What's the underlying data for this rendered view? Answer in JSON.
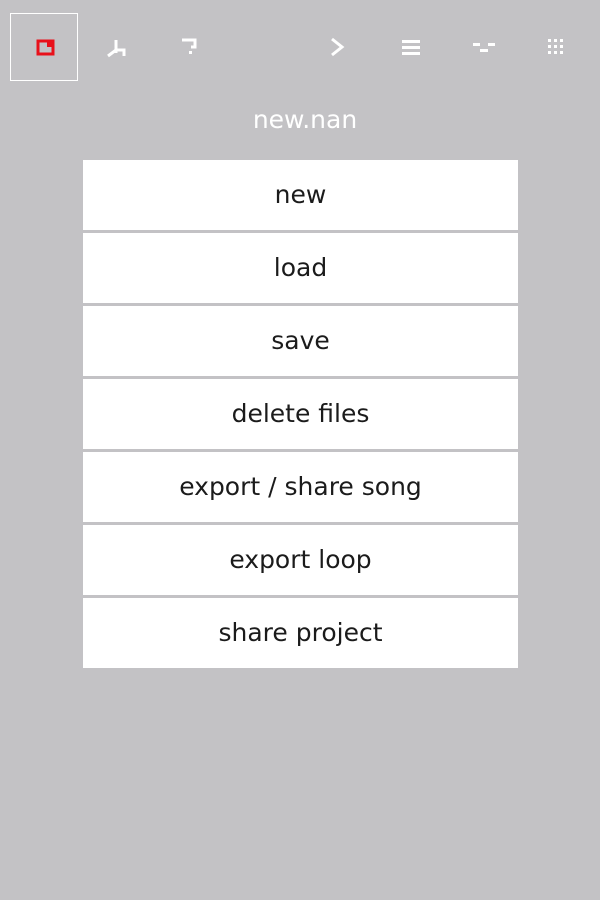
{
  "toolbar": {
    "active_index": 0,
    "active_icon_color": "#e8101a",
    "icon_color": "#ffffff",
    "items": [
      {
        "icon": "file-menu-icon",
        "active": true
      },
      {
        "icon": "settings-icon",
        "active": false
      },
      {
        "icon": "help-icon",
        "active": false
      },
      {
        "icon": "play-icon",
        "active": false
      },
      {
        "icon": "list-icon",
        "active": false
      },
      {
        "icon": "sequence-icon",
        "active": false
      },
      {
        "icon": "grid-icon",
        "active": false
      }
    ]
  },
  "file": {
    "name": "new.nan"
  },
  "menu": {
    "items": [
      {
        "label": "new"
      },
      {
        "label": "load"
      },
      {
        "label": "save"
      },
      {
        "label": "delete files"
      },
      {
        "label": "export / share song"
      },
      {
        "label": "export loop"
      },
      {
        "label": "share project"
      }
    ]
  }
}
